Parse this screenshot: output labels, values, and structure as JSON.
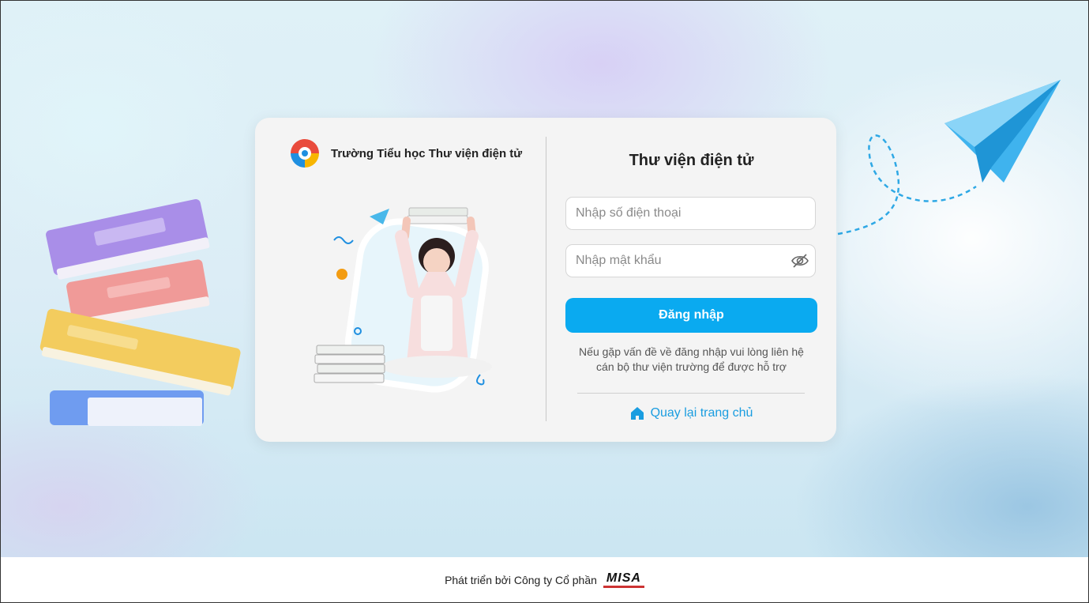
{
  "brand": {
    "school_name": "Trường Tiểu học Thư viện điện tử",
    "logo_icon": "school-logo-icon"
  },
  "login": {
    "title": "Thư viện điện tử",
    "phone_placeholder": "Nhập số điện thoại",
    "password_placeholder": "Nhập mật khẩu",
    "submit_label": "Đăng nhập",
    "help_line1": "Nếu gặp vấn đề về đăng nhập vui lòng liên hệ",
    "help_line2": "cán bộ thư viện trường để được hỗ trợ",
    "home_link": "Quay lại trang chủ"
  },
  "footer": {
    "text": "Phát triển bởi Công ty Cổ phần",
    "company_logo_text": "MISA"
  },
  "colors": {
    "primary": "#0aaaf0",
    "link": "#1a9de0",
    "card": "#f4f4f4"
  }
}
